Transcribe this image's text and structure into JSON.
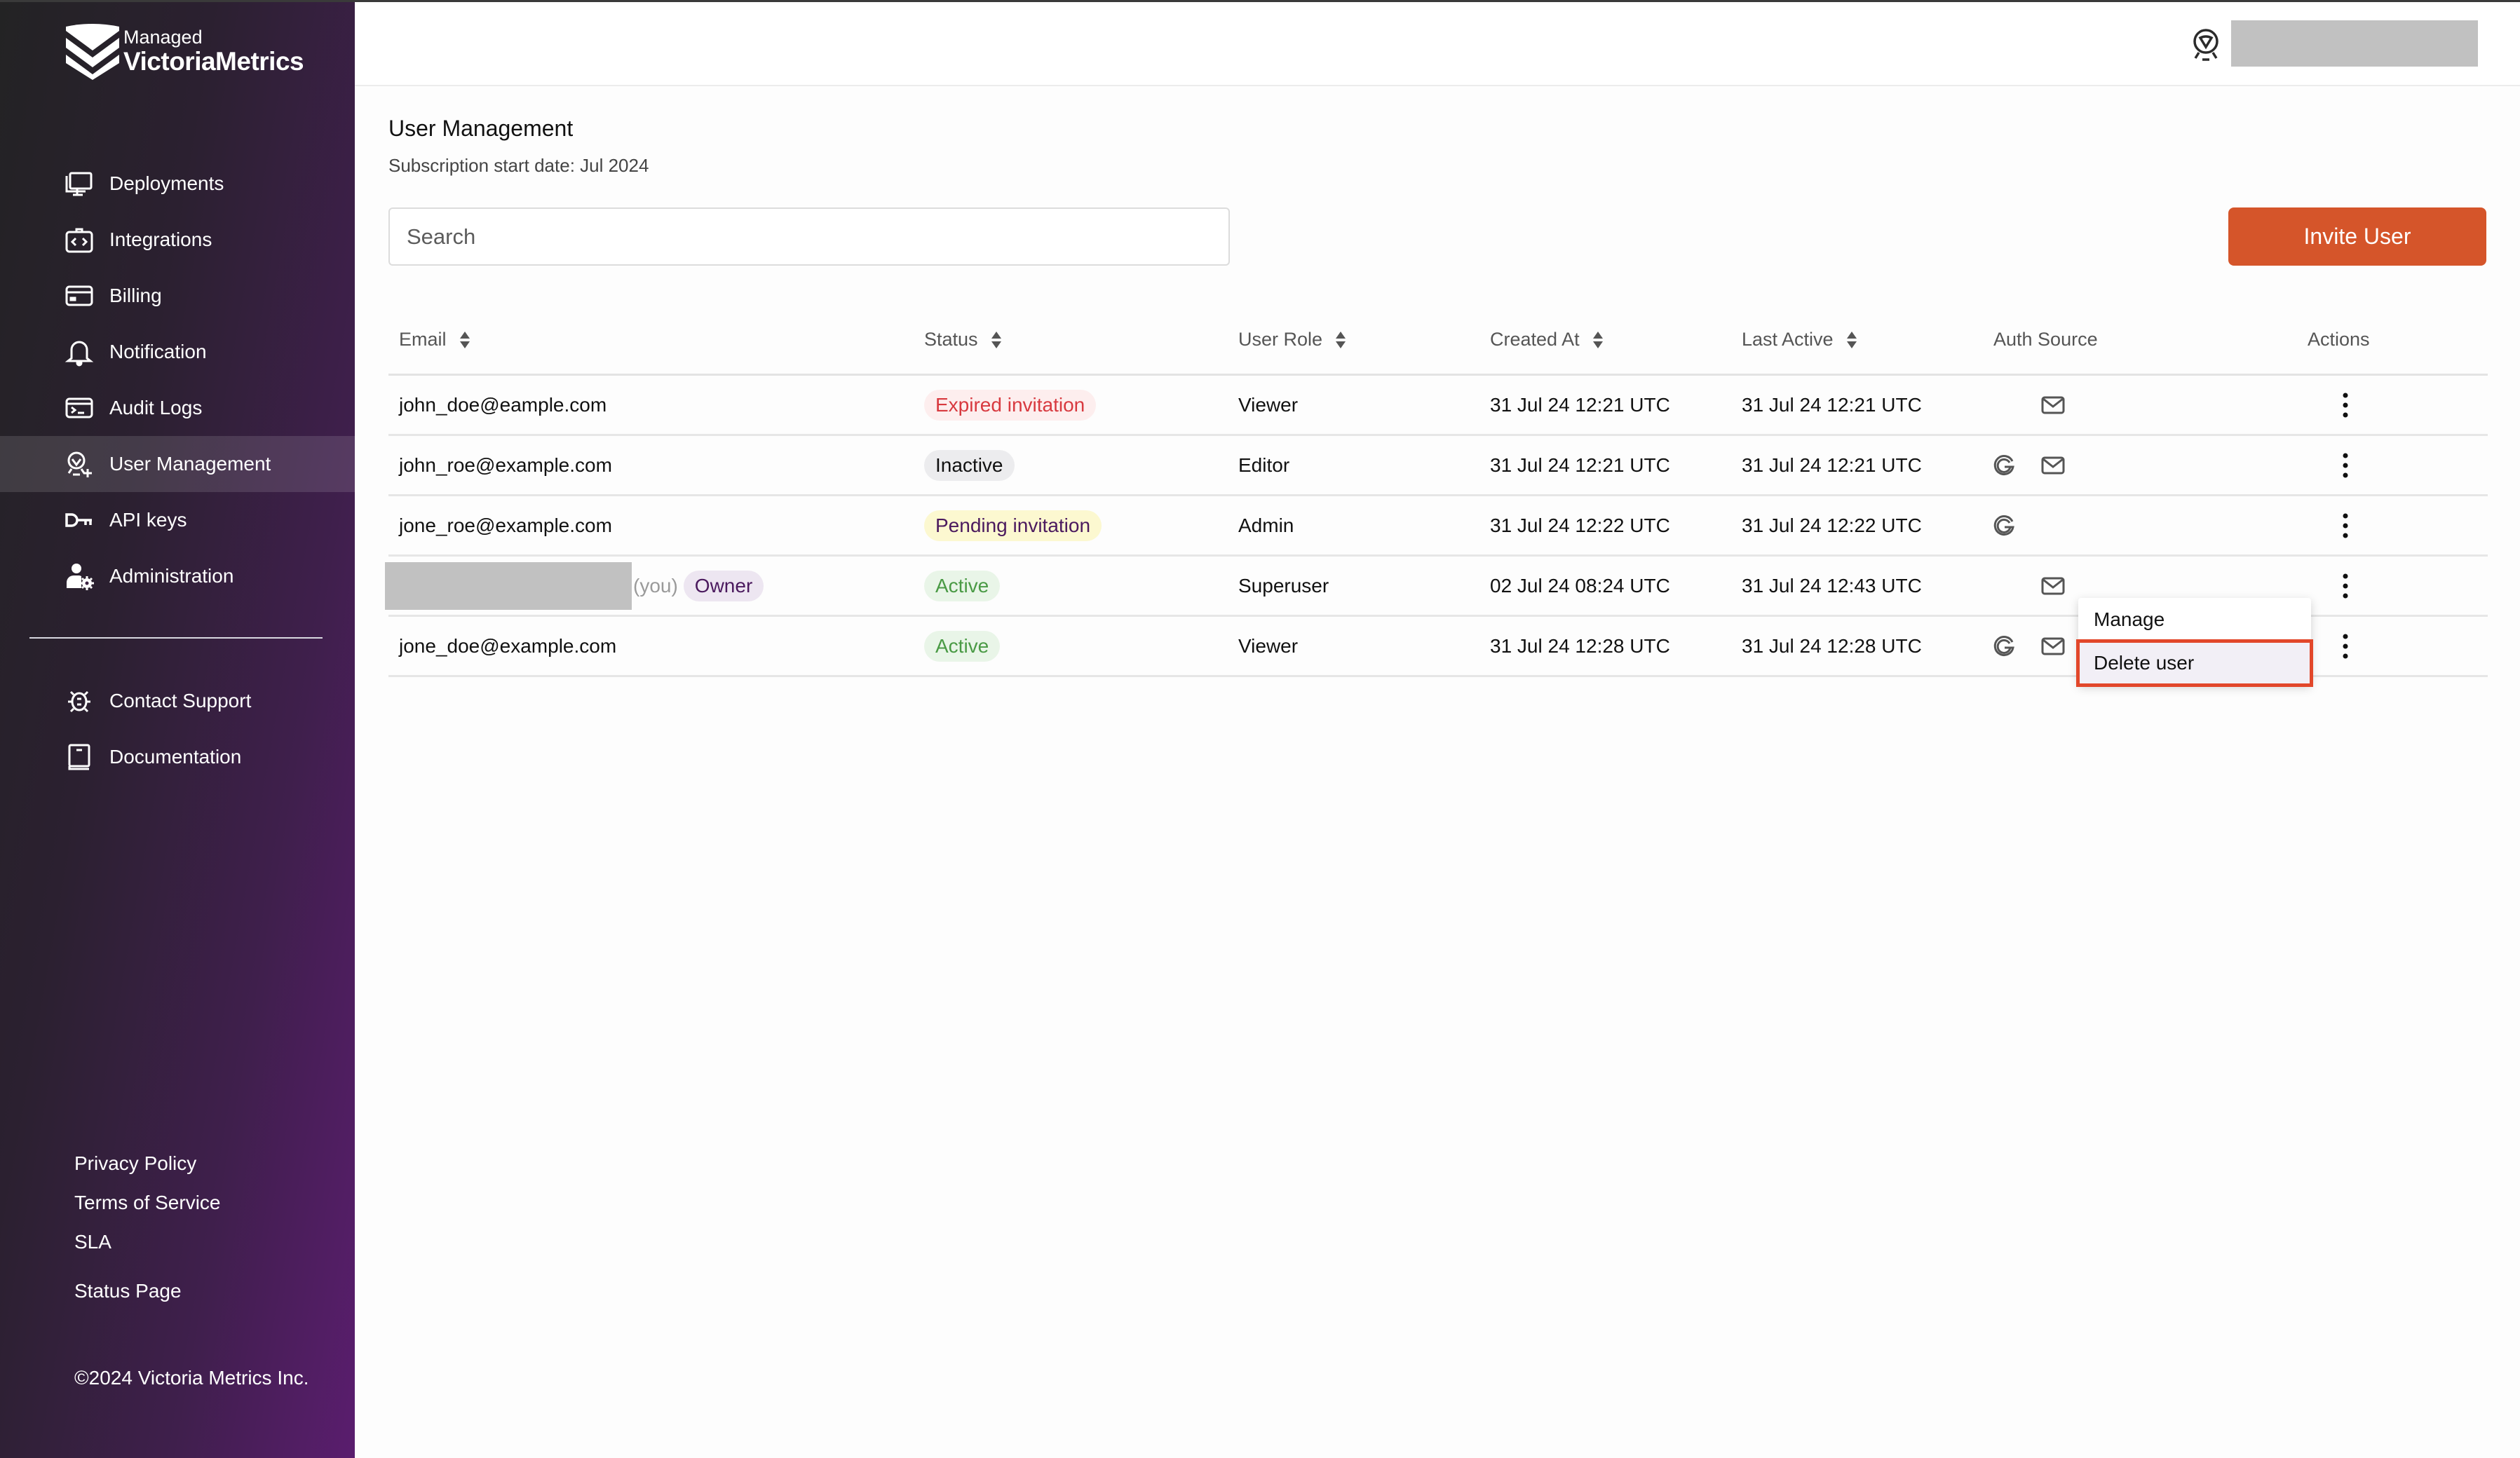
{
  "brand": {
    "line1": "Managed",
    "line2": "VictoriaMetrics"
  },
  "sidebar": {
    "items": [
      {
        "label": "Deployments",
        "icon": "monitor-icon"
      },
      {
        "label": "Integrations",
        "icon": "integrations-icon"
      },
      {
        "label": "Billing",
        "icon": "credit-card-icon"
      },
      {
        "label": "Notification",
        "icon": "bell-icon"
      },
      {
        "label": "Audit Logs",
        "icon": "terminal-icon"
      },
      {
        "label": "User Management",
        "icon": "user-add-icon",
        "active": true
      },
      {
        "label": "API keys",
        "icon": "key-icon"
      },
      {
        "label": "Administration",
        "icon": "user-gear-icon"
      }
    ],
    "secondary": [
      {
        "label": "Contact Support",
        "icon": "bug-icon"
      },
      {
        "label": "Documentation",
        "icon": "book-icon"
      }
    ],
    "footer_links": [
      "Privacy Policy",
      "Terms of Service",
      "SLA",
      "Status Page"
    ],
    "copyright": "©2024 Victoria Metrics Inc."
  },
  "header": {
    "account_icon": "user-badge-icon",
    "user_name_redacted": true
  },
  "main": {
    "title": "User Management",
    "subtitle": "Subscription start date: Jul 2024",
    "search": {
      "placeholder": "Search",
      "value": ""
    },
    "invite_button": "Invite User"
  },
  "colors": {
    "accent": "#d5552a",
    "highlight_outline": "#e2472a",
    "expired": "#d8393f",
    "pending_text": "#4b1a5e",
    "active": "#4a9a45"
  },
  "table": {
    "columns": [
      {
        "label": "Email",
        "sortable": true
      },
      {
        "label": "Status",
        "sortable": true
      },
      {
        "label": "User Role",
        "sortable": true
      },
      {
        "label": "Created At",
        "sortable": true
      },
      {
        "label": "Last Active",
        "sortable": true
      },
      {
        "label": "Auth Source",
        "sortable": false
      },
      {
        "label": "Actions",
        "sortable": false
      }
    ],
    "rows": [
      {
        "email": "john_doe@eample.com",
        "status": "Expired invitation",
        "status_kind": "expired",
        "role": "Viewer",
        "created": "31 Jul 24 12:21 UTC",
        "last_active": "31 Jul 24 12:21 UTC",
        "auth": [
          "email"
        ]
      },
      {
        "email": "john_roe@example.com",
        "status": "Inactive",
        "status_kind": "inactive",
        "role": "Editor",
        "created": "31 Jul 24 12:21 UTC",
        "last_active": "31 Jul 24 12:21 UTC",
        "auth": [
          "google",
          "email"
        ]
      },
      {
        "email": "jone_roe@example.com",
        "status": "Pending invitation",
        "status_kind": "pending",
        "role": "Admin",
        "created": "31 Jul 24 12:22 UTC",
        "last_active": "31 Jul 24 12:22 UTC",
        "auth": [
          "google"
        ]
      },
      {
        "email": "",
        "email_redacted": true,
        "you_label": "(you)",
        "owner_label": "Owner",
        "status": "Active",
        "status_kind": "active",
        "role": "Superuser",
        "created": "02 Jul 24 08:24 UTC",
        "last_active": "31 Jul 24 12:43 UTC",
        "auth": [
          "email"
        ]
      },
      {
        "email": "jone_doe@example.com",
        "status": "Active",
        "status_kind": "active",
        "role": "Viewer",
        "created": "31 Jul 24 12:28 UTC",
        "last_active": "31 Jul 24 12:28 UTC",
        "auth": [
          "google",
          "email"
        ]
      }
    ]
  },
  "actions_menu": {
    "open_for_row": 4,
    "items": [
      {
        "label": "Manage",
        "highlighted": false
      },
      {
        "label": "Delete user",
        "highlighted": true
      }
    ]
  }
}
